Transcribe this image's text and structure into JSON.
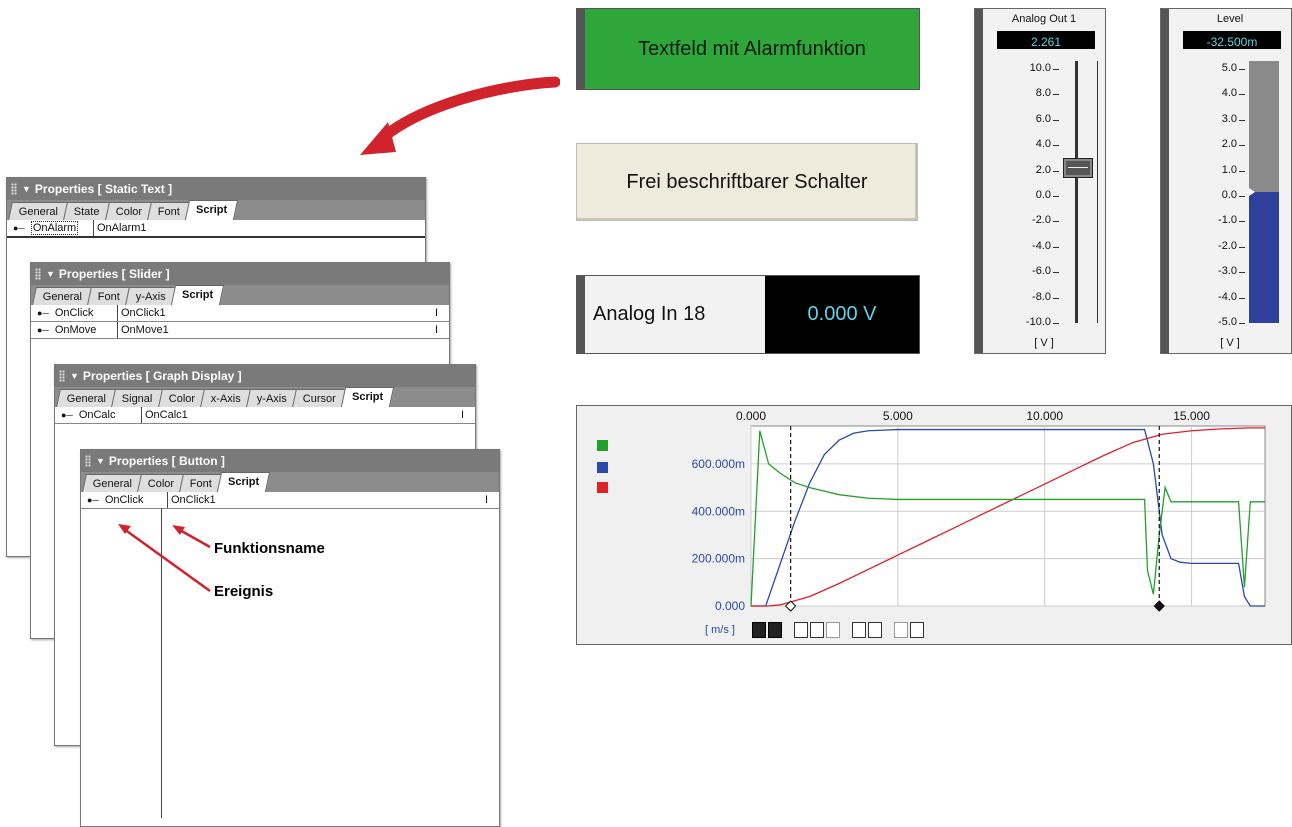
{
  "panels": {
    "static_text": {
      "title": "Properties  [ Static Text ]",
      "tabs": [
        "General",
        "State",
        "Color",
        "Font",
        "Script"
      ],
      "rows": [
        {
          "event": "OnAlarm",
          "func": "OnAlarm1"
        }
      ]
    },
    "slider": {
      "title": "Properties  [ Slider ]",
      "tabs": [
        "General",
        "Font",
        "y-Axis",
        "Script"
      ],
      "rows": [
        {
          "event": "OnClick",
          "func": "OnClick1"
        },
        {
          "event": "OnMove",
          "func": "OnMove1"
        }
      ]
    },
    "graph": {
      "title": "Properties  [ Graph Display ]",
      "tabs": [
        "General",
        "Signal",
        "Color",
        "x-Axis",
        "y-Axis",
        "Cursor",
        "Script"
      ],
      "rows": [
        {
          "event": "OnCalc",
          "func": "OnCalc1"
        }
      ]
    },
    "button": {
      "title": "Properties  [ Button ]",
      "tabs": [
        "General",
        "Color",
        "Font",
        "Script"
      ],
      "rows": [
        {
          "event": "OnClick",
          "func": "OnClick1"
        }
      ]
    },
    "ibeam": "I"
  },
  "annotations": {
    "function_name": "Funktionsname",
    "event": "Ereignis"
  },
  "widgets": {
    "alarm_text": "Textfeld mit Alarmfunktion",
    "free_button": "Frei beschriftbarer Schalter",
    "analog_in": {
      "label": "Analog In 18",
      "value": "0.000 V"
    },
    "analog_out": {
      "title": "Analog Out 1",
      "value": "2.261",
      "unit": "[ V ]",
      "ticks": [
        "10.0",
        "8.0",
        "6.0",
        "4.0",
        "2.0",
        "0.0",
        "-2.0",
        "-4.0",
        "-6.0",
        "-8.0",
        "-10.0"
      ],
      "slider_value": 2.261,
      "min": -10,
      "max": 10
    },
    "level": {
      "title": "Level",
      "value": "-32.500m",
      "unit": "[ V ]",
      "ticks": [
        "5.0",
        "4.0",
        "3.0",
        "2.0",
        "1.0",
        "0.0",
        "-1.0",
        "-2.0",
        "-3.0",
        "-4.0",
        "-5.0"
      ],
      "level_value": 0.0,
      "min": -5,
      "max": 5
    }
  },
  "chart_data": {
    "type": "line",
    "x_ticks": [
      "0.000",
      "5.000",
      "10.000",
      "15.000"
    ],
    "y_ticks": [
      "600.000m",
      "400.000m",
      "200.000m",
      "0.000"
    ],
    "ylabel": "[ m/s ]",
    "xlim": [
      0,
      17.5
    ],
    "ylim": [
      0,
      760
    ],
    "grid": true,
    "colors": {
      "green": "#22a12a",
      "blue": "#2b49a8",
      "red": "#e0202a"
    },
    "cursors": [
      1.35,
      13.9
    ],
    "series": [
      {
        "color": "blue",
        "x": [
          0,
          0.5,
          1,
          1.5,
          2,
          2.5,
          3,
          3.5,
          4,
          5,
          6,
          8,
          10,
          12,
          13.4,
          13.7,
          14,
          14.3,
          14.6,
          15,
          16,
          16.6,
          16.8,
          17,
          17.5
        ],
        "y": [
          0,
          0,
          180,
          360,
          520,
          640,
          700,
          730,
          740,
          745,
          745,
          745,
          745,
          745,
          745,
          600,
          300,
          200,
          185,
          180,
          180,
          180,
          40,
          0,
          0
        ]
      },
      {
        "color": "red",
        "x": [
          0,
          0.6,
          1,
          2,
          3,
          4,
          5,
          6,
          7,
          8,
          9,
          10,
          11,
          12,
          13,
          14,
          15,
          16,
          17,
          17.5
        ],
        "y": [
          0,
          0,
          5,
          40,
          95,
          155,
          215,
          275,
          335,
          395,
          455,
          515,
          575,
          635,
          690,
          725,
          740,
          748,
          752,
          752
        ]
      },
      {
        "color": "green",
        "x": [
          0,
          0.3,
          0.6,
          1,
          1.5,
          2,
          2.5,
          3,
          4,
          5,
          6,
          8,
          10,
          12,
          13.4,
          13.5,
          13.7,
          13.9,
          14.1,
          14.3,
          15,
          16,
          16.6,
          16.8,
          17,
          17.5
        ],
        "y": [
          0,
          740,
          600,
          560,
          520,
          500,
          485,
          470,
          455,
          450,
          450,
          450,
          450,
          450,
          450,
          150,
          50,
          300,
          500,
          440,
          440,
          440,
          440,
          80,
          440,
          440
        ]
      }
    ]
  }
}
